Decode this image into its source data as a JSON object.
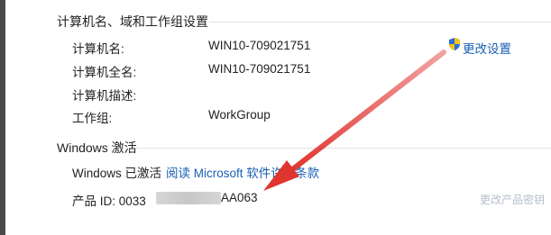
{
  "computer_section": {
    "title": "计算机名、域和工作组设置",
    "rows": [
      {
        "label": "计算机名:",
        "value": "WIN10-709021751"
      },
      {
        "label": "计算机全名:",
        "value": "WIN10-709021751"
      },
      {
        "label": "计算机描述:",
        "value": ""
      },
      {
        "label": "工作组:",
        "value": "WorkGroup"
      }
    ],
    "change_settings": {
      "label": "更改设置",
      "icon": "uac-shield-icon"
    }
  },
  "activation_section": {
    "title": "Windows 激活",
    "status": "Windows 已激活",
    "license_link": "阅读 Microsoft 软件许可条款",
    "product_id_prefix": "产品 ID: 0033",
    "product_id_suffix": "AA063",
    "change_key_link": "更改产品密钥"
  },
  "colors": {
    "link": "#1a5fb4",
    "arrow": "#e0342f"
  }
}
